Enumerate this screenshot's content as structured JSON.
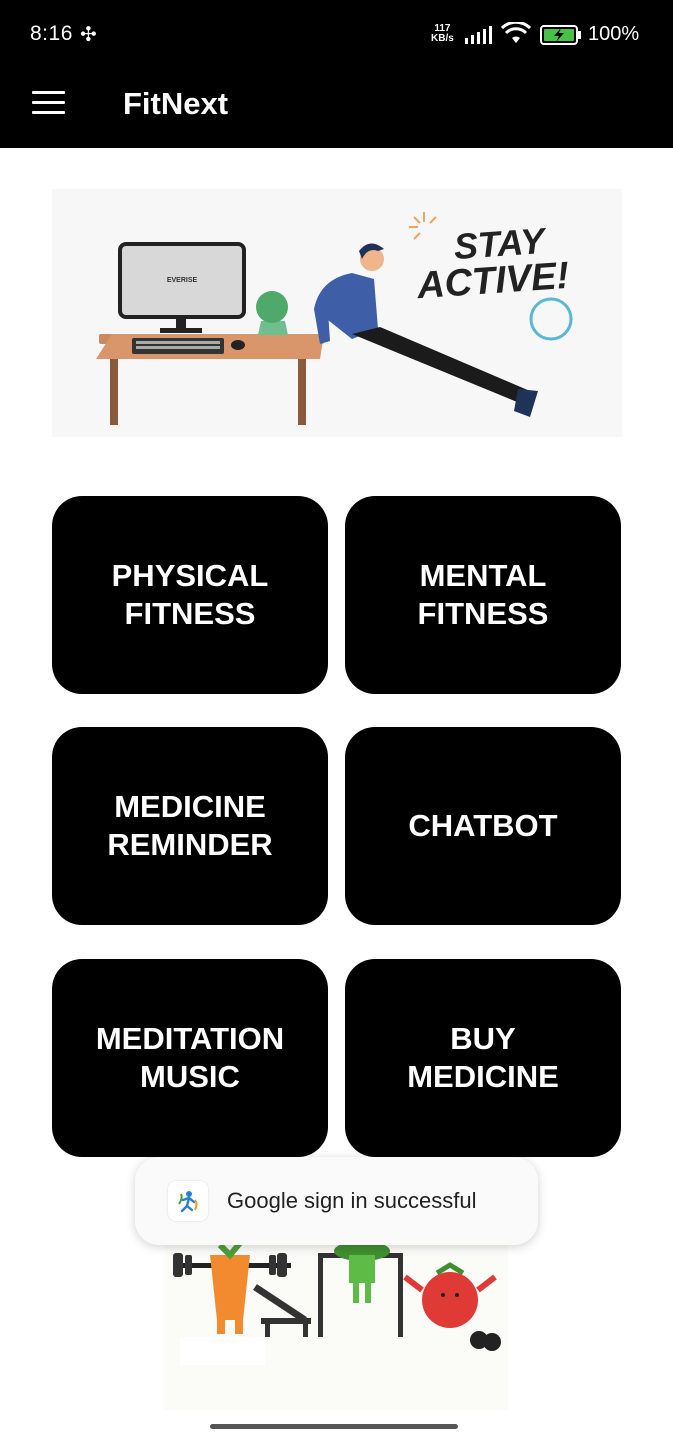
{
  "status_bar": {
    "time": "8:16",
    "speed_value": "117",
    "speed_unit": "KB/s",
    "battery": "100%"
  },
  "app_bar": {
    "title": "FitNext"
  },
  "banner": {
    "headline_line1": "STAY",
    "headline_line2": "ACTIVE!",
    "monitor_text": "EVERISE"
  },
  "tiles": [
    {
      "label": "PHYSICAL\nFITNESS"
    },
    {
      "label": "MENTAL\nFITNESS"
    },
    {
      "label": "MEDICINE\nREMINDER"
    },
    {
      "label": "CHATBOT"
    },
    {
      "label": "MEDITATION\nMUSIC"
    },
    {
      "label": "BUY\nMEDICINE"
    }
  ],
  "toast": {
    "message": "Google sign in successful"
  },
  "colors": {
    "app_bar": "#000000",
    "tile_bg": "#000000",
    "tile_text": "#ffffff"
  }
}
